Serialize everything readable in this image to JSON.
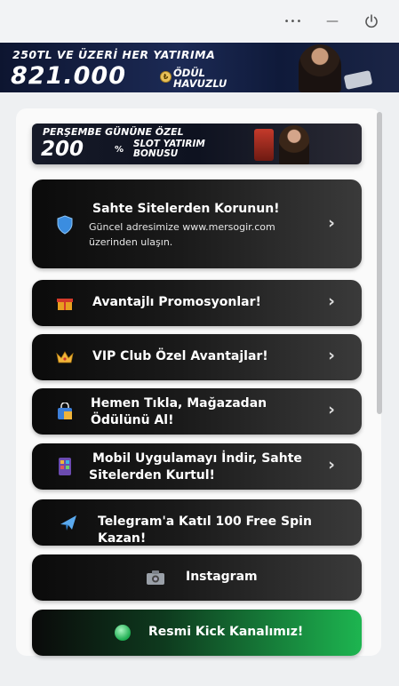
{
  "window": {
    "more_label": "•••",
    "minimize_label": "—"
  },
  "top_banner": {
    "line1": "250TL VE ÜZERİ HER YATIRIMA",
    "amount": "821.000",
    "currency": "₺",
    "line2a": "ÖDÜL",
    "line2b": "HAVUZLU"
  },
  "mid_banner": {
    "line1": "PERŞEMBE GÜNÜNE ÖZEL",
    "amount": "200",
    "percent": "%",
    "line2a": "SLOT YATIRIM",
    "line2b": "BONUSU"
  },
  "links": [
    {
      "icon": "shield-icon",
      "title": "Sahte Sitelerden Korunun!",
      "desc_line1": "Güncel adresimize www.mersogir.com",
      "desc_line2": "üzerinden ulaşın."
    },
    {
      "icon": "gift-icon",
      "title": "Avantajlı Promosyonlar!"
    },
    {
      "icon": "crown-icon",
      "title": "VIP Club Özel Avantajlar!"
    },
    {
      "icon": "shopping-bag-icon",
      "title_line1": "Hemen Tıkla, Mağazadan",
      "title_line2": "Ödülünü Al!"
    },
    {
      "icon": "mobile-phone-icon",
      "title_line1": "Mobil Uygulamayı İndir, Sahte",
      "title_line2": "Sitelerden Kurtul!"
    },
    {
      "icon": "airplane-icon",
      "title": "Telegram'a Katıl 100 Free Spin Kazan!"
    },
    {
      "icon": "camera-icon",
      "title": "Instagram"
    },
    {
      "icon": "green-circle-icon",
      "title": "Resmi Kick Kanalımız!"
    }
  ],
  "colors": {
    "card_dark": "#0b0b0b",
    "card_light": "#3a3a3a",
    "kick_green": "#1db550"
  }
}
